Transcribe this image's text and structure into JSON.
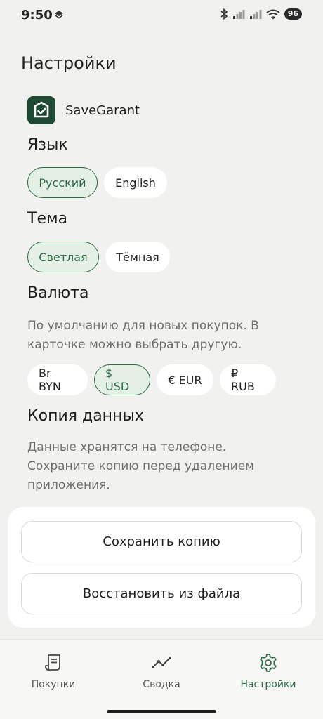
{
  "status": {
    "time": "9:50",
    "battery": "96"
  },
  "page": {
    "title": "Настройки"
  },
  "brand": {
    "name": "SaveGarant"
  },
  "language": {
    "title": "Язык",
    "options": [
      {
        "label": "Русский",
        "selected": true
      },
      {
        "label": "English",
        "selected": false
      }
    ]
  },
  "theme": {
    "title": "Тема",
    "options": [
      {
        "label": "Светлая",
        "selected": true
      },
      {
        "label": "Тёмная",
        "selected": false
      }
    ]
  },
  "currency": {
    "title": "Валюта",
    "description": "По умолчанию для новых покупок. В карточке можно выбрать другую.",
    "options": [
      {
        "label": "Br BYN",
        "selected": false
      },
      {
        "label": "$ USD",
        "selected": true
      },
      {
        "label": "€ EUR",
        "selected": false
      },
      {
        "label": "₽ RUB",
        "selected": false
      }
    ]
  },
  "backup": {
    "title": "Копия данных",
    "description": "Данные хранятся на телефоне. Сохраните копию перед удалением приложения.",
    "save_label": "Сохранить копию",
    "restore_label": "Восстановить из файла"
  },
  "nav": {
    "items": [
      {
        "label": "Покупки",
        "icon": "receipt-icon",
        "active": false
      },
      {
        "label": "Сводка",
        "icon": "trend-chart-icon",
        "active": false
      },
      {
        "label": "Настройки",
        "icon": "gear-icon",
        "active": true
      }
    ]
  },
  "colors": {
    "accent": "#2e6b45",
    "accent_bg": "#e4f0e6",
    "brand_logo": "#1e4a33"
  }
}
